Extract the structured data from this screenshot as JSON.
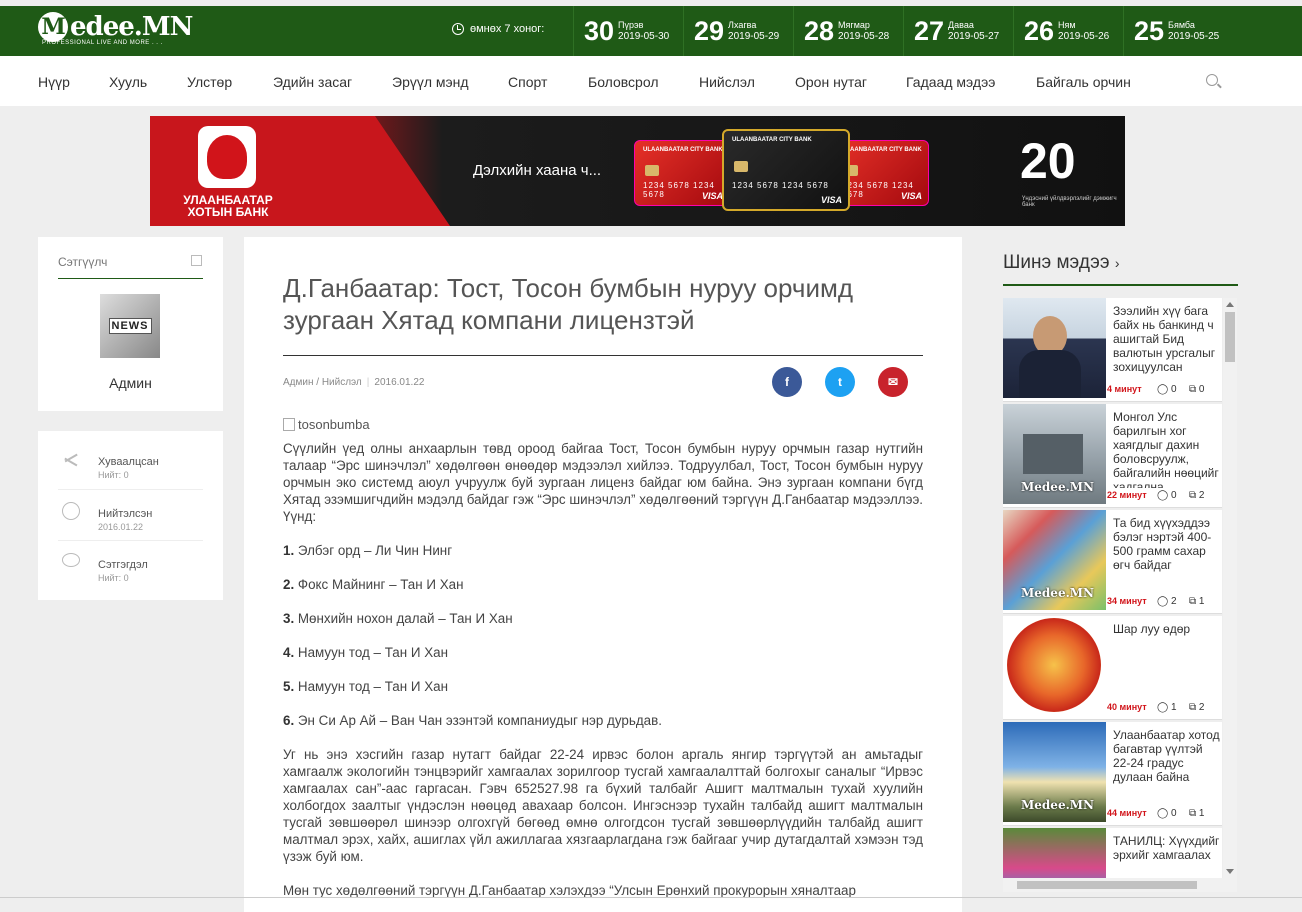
{
  "header": {
    "logo_main": "edee.MN",
    "logo_letter": "M",
    "logo_sub": "PROFESSIONAL LIVE AND MORE . . .",
    "week_label": "өмнөх 7 хоног:",
    "days": [
      {
        "num": "30",
        "name": "Пүрэв",
        "date": "2019-05-30"
      },
      {
        "num": "29",
        "name": "Лхагва",
        "date": "2019-05-29"
      },
      {
        "num": "28",
        "name": "Мягмар",
        "date": "2019-05-28"
      },
      {
        "num": "27",
        "name": "Даваа",
        "date": "2019-05-27"
      },
      {
        "num": "26",
        "name": "Ням",
        "date": "2019-05-26"
      },
      {
        "num": "25",
        "name": "Бямба",
        "date": "2019-05-25"
      }
    ]
  },
  "nav": [
    "Нүүр",
    "Хууль",
    "Улстөр",
    "Эдийн засаг",
    "Эрүүл мэнд",
    "Спорт",
    "Боловсрол",
    "Нийслэл",
    "Орон нутаг",
    "Гадаад мэдээ",
    "Байгаль орчин"
  ],
  "banner": {
    "bank_name": "УЛААНБААТАР ХОТЫН БАНК",
    "slogan": "Дэлхийн хаана ч...",
    "card_brand": "ULAANBAATAR CITY BANK",
    "card_number": "1234 5678 1234 5678",
    "card_network": "VISA",
    "anniversary": "20",
    "anniversary_sub": "Үндэсний үйлдвэрлэлийг дэмжигч банк"
  },
  "author": {
    "title": "Сэтгүүлч",
    "avatar_text": "NEWS",
    "name": "Админ"
  },
  "stats": [
    {
      "label": "Хуваалцсан",
      "value": "Нийт: 0"
    },
    {
      "label": "Нийтэлсэн",
      "value": "2016.01.22"
    },
    {
      "label": "Сэтгэгдэл",
      "value": "Нийт: 0"
    }
  ],
  "article": {
    "title": "Д.Ганбаатар: Тост, Тосон бумбын нуруу орчимд зургаан Хятад компани лицензтэй",
    "meta_author": "Админ / Нийслэл",
    "meta_date": "2016.01.22",
    "image_alt": "tosonbumba",
    "intro": "Сүүлийн үед олны анхаарлын төвд ороод байгаа Тост, Тосон бумбын нуруу орчмын газар нутгийн талаар “Эрс шинэчлэл” хөдөлгөөн өнөөдөр мэдээлэл хийлээ. Тодруулбал, Тост, Тосон бумбын нуруу орчмын эко системд аюул учруулж буй зургаан лиценз байдаг юм байна. Энэ зургаан компани бүгд Хятад эзэмшигчдийн мэдэлд байдаг гэж “Эрс шинэчлэл” хөдөлгөөний тэргүүн Д.Ганбаатар мэдээллээ. Үүнд:",
    "list": [
      {
        "n": "1.",
        "t": "Элбэг орд – Ли Чин Нинг"
      },
      {
        "n": "2.",
        "t": "Фокс Майнинг – Тан И Хан"
      },
      {
        "n": "3.",
        "t": "Мөнхийн нохон далай – Тан И Хан"
      },
      {
        "n": "4.",
        "t": "Намуун тод – Тан И Хан"
      },
      {
        "n": "5.",
        "t": "Намуун тод – Тан И Хан"
      },
      {
        "n": "6.",
        "t": "Эн Си Ар Ай – Ван Чан эзэнтэй компаниудыг нэр дурьдав."
      }
    ],
    "para2": "Уг нь энэ хэсгийн газар нутагт байдаг 22-24 ирвэс болон аргаль янгир тэргүүтэй ан амьтадыг хамгаалж экологийн тэнцвэрийг хамгаалах зорилгоор тусгай хамгаалалттай болгохыг саналыг “Ирвэс хамгаалах сан”-аас гаргасан. Гэвч 652527.98 га бүхий талбайг Ашигт малтмалын тухай хуулийн холбогдох заалтыг үндэслэн нөөцөд авахаар болсон. Ингэснээр тухайн талбайд ашигт малтмалын тусгай зөвшөөрөл шинээр олгохгүй бөгөөд өмнө олгогдсон тусгай зөвшөөрлүүдийн талбайд ашигт малтмал эрэх, хайх, ашиглах үйл ажиллагаа хязгаарлагдана гэж байгааг учир дутагдалтай хэмээн тэд үзэж буй юм.",
    "para3": "Мөн тус хөдөлгөөний тэргүүн Д.Ганбаатар хэлэхдээ “Улсын Ерөнхий прокурорын хяналтаар"
  },
  "news": {
    "heading": "Шинэ мэдээ",
    "items": [
      {
        "text": "Зээлийн хүү бага байх нь банкинд ч ашигтай Бид валютын урсгалыг зохицуулсан",
        "time": "4 минут",
        "comments": "0",
        "shares": "0"
      },
      {
        "text": "Монгол Улс барилгын хог хаягдлыг дахин боловсруулж, байгалийн нөөцийг хадгална",
        "time": "22 минут",
        "comments": "0",
        "shares": "2"
      },
      {
        "text": "Та бид хүүхэддээ бэлэг нэртэй 400-500 грамм сахар өгч байдаг",
        "time": "34 минут",
        "comments": "2",
        "shares": "1"
      },
      {
        "text": "Шар луу өдөр",
        "time": "40 минут",
        "comments": "1",
        "shares": "2"
      },
      {
        "text": "Улаанбаатар хотод багавтар үүлтэй 22-24 градус дулаан байна",
        "time": "44 минут",
        "comments": "0",
        "shares": "1"
      },
      {
        "text": "ТАНИЛЦ: Хүүхдийг эрхийг хамгаалах",
        "time": "",
        "comments": "",
        "shares": ""
      }
    ],
    "watermark": "Medee.MN"
  }
}
